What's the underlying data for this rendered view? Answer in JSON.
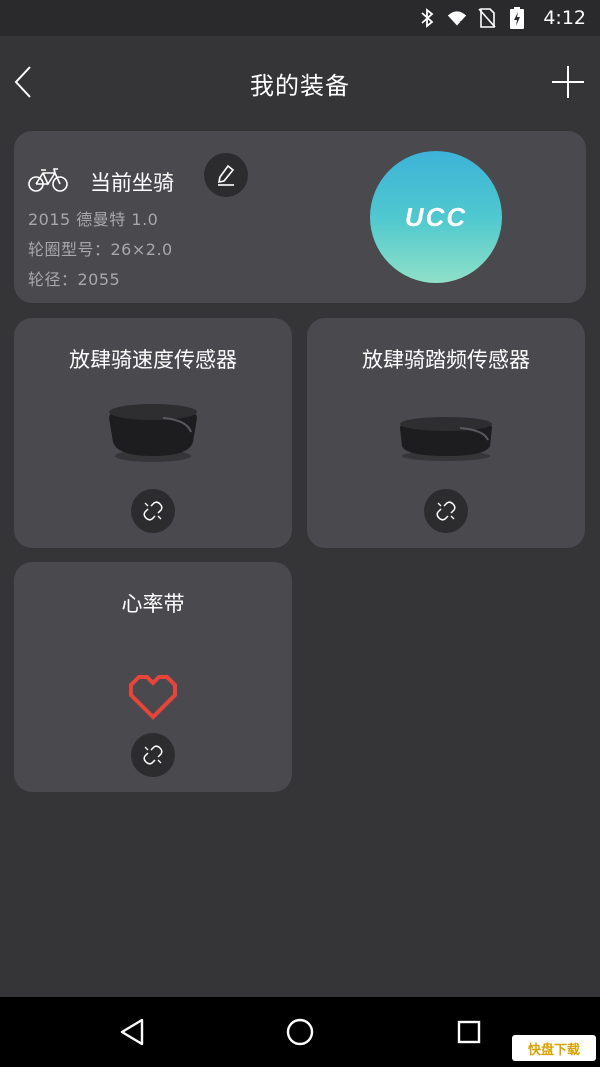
{
  "status_bar": {
    "time": "4:12",
    "icons": [
      "bluetooth-icon",
      "wifi-icon",
      "no-sim-icon",
      "battery-charging-icon"
    ]
  },
  "header": {
    "title": "我的装备",
    "back_icon": "chevron-left-icon",
    "add_icon": "plus-icon"
  },
  "bike": {
    "title": "当前坐骑",
    "model": "2015 德曼特 1.0",
    "rim": "轮圈型号：26×2.0",
    "wheel": "轮径：2055",
    "brand": "UCC",
    "brand_gradient": [
      "#3db3d8",
      "#8fe0c8"
    ]
  },
  "devices": [
    {
      "title": "放肆骑速度传感器",
      "icon": "speed-sensor-icon",
      "action_icon": "unlink-icon"
    },
    {
      "title": "放肆骑踏频传感器",
      "icon": "cadence-sensor-icon",
      "action_icon": "unlink-icon"
    },
    {
      "title": "心率带",
      "icon": "heart-icon",
      "action_icon": "unlink-icon",
      "accent": "#e8443a"
    }
  ],
  "watermark": "快盘下载",
  "colors": {
    "background": "#353538",
    "card": "#4a494e",
    "muted_text": "#a8a8ab"
  }
}
